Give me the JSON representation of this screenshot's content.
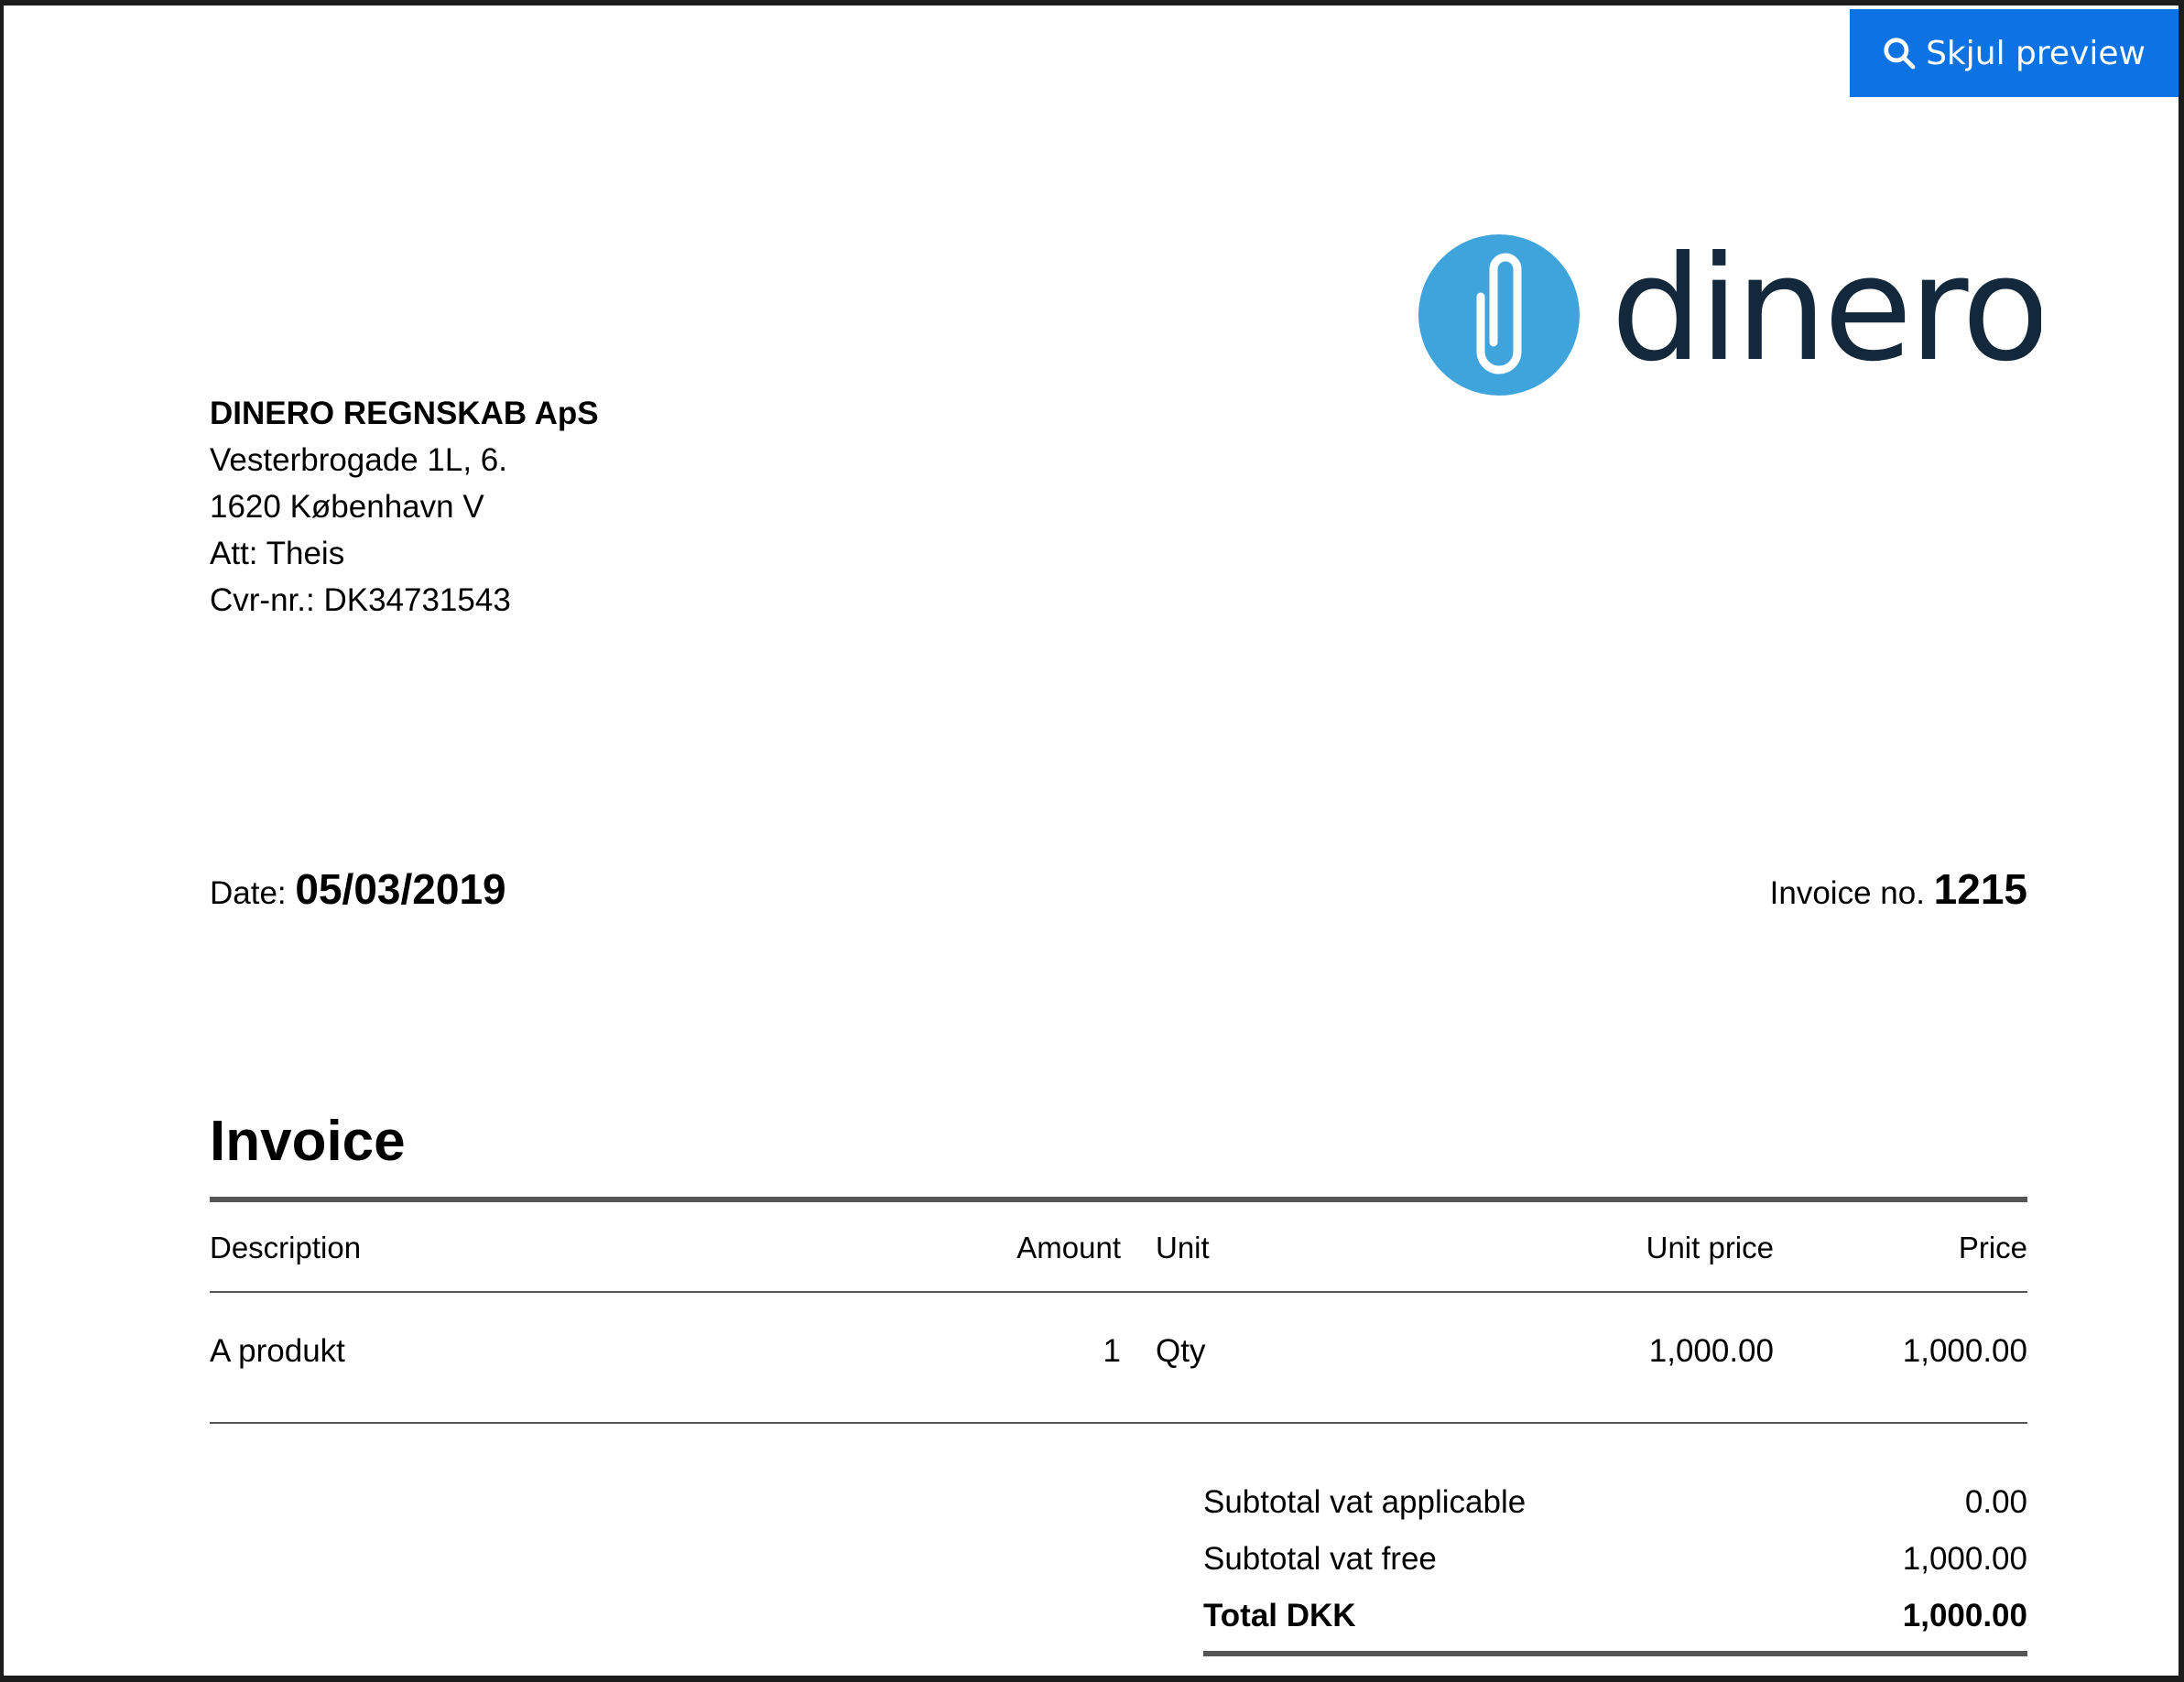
{
  "toolbar": {
    "preview_label": "Skjul preview",
    "accent_color": "#0d72e3"
  },
  "logo": {
    "text": "dinero.",
    "icon": "paperclip-icon",
    "brand_blue": "#3fa3dc",
    "brand_dark": "#13283a"
  },
  "sender": {
    "company": "DINERO REGNSKAB ApS",
    "street": "Vesterbrogade 1L, 6.",
    "city": "1620 København V",
    "attention": "Att: Theis",
    "cvr": "Cvr-nr.: DK34731543"
  },
  "meta": {
    "date_label": "Date:",
    "date_value": "05/03/2019",
    "invoice_no_label": "Invoice no.",
    "invoice_no_value": "1215"
  },
  "document": {
    "heading": "Invoice"
  },
  "table": {
    "headers": {
      "description": "Description",
      "amount": "Amount",
      "unit": "Unit",
      "unit_price": "Unit price",
      "price": "Price"
    },
    "rows": [
      {
        "description": "A produkt",
        "amount": "1",
        "unit": "Qty",
        "unit_price": "1,000.00",
        "price": "1,000.00"
      }
    ]
  },
  "totals": {
    "vat_applicable_label": "Subtotal vat applicable",
    "vat_applicable_value": "0.00",
    "vat_free_label": "Subtotal vat free",
    "vat_free_value": "1,000.00",
    "total_label": "Total DKK",
    "total_value": "1,000.00"
  }
}
